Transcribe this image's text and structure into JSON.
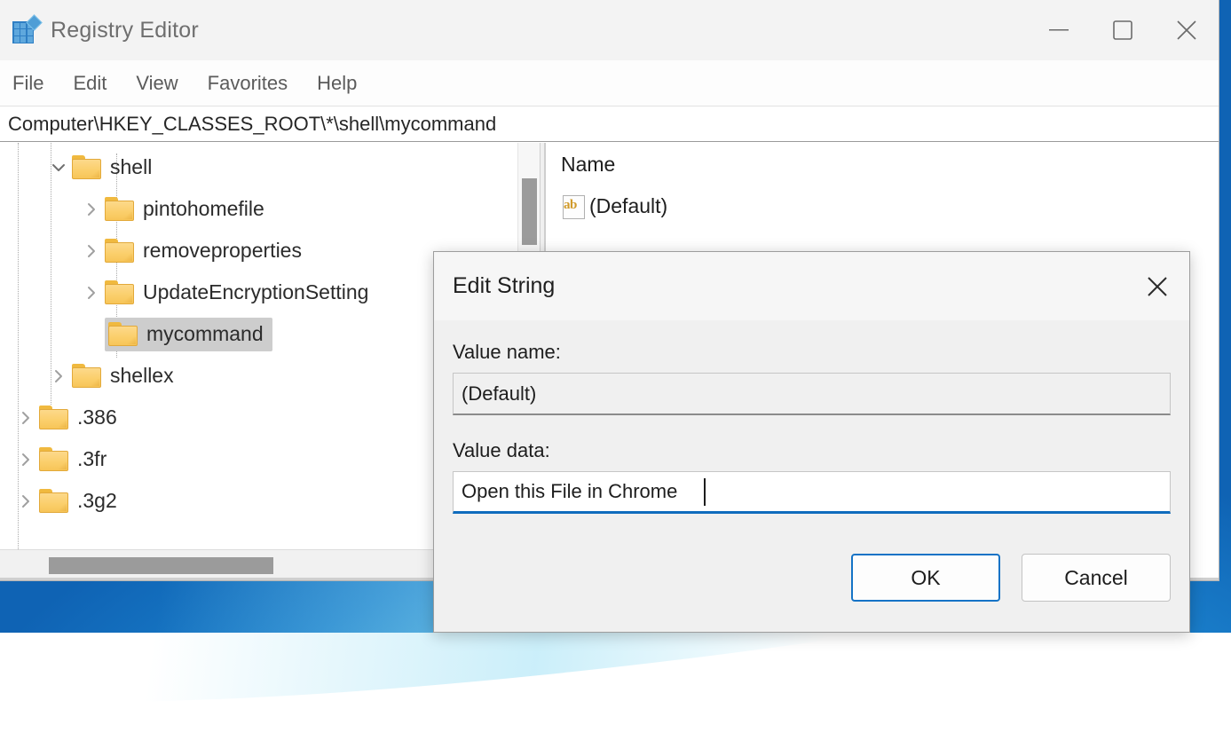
{
  "window": {
    "title": "Registry Editor",
    "icon": "registry-editor-icon",
    "controls": {
      "minimize": "minimize-icon",
      "maximize": "maximize-icon",
      "close": "close-icon"
    }
  },
  "menubar": {
    "items": [
      {
        "label": "File"
      },
      {
        "label": "Edit"
      },
      {
        "label": "View"
      },
      {
        "label": "Favorites"
      },
      {
        "label": "Help"
      }
    ]
  },
  "addressbar": {
    "path": "Computer\\HKEY_CLASSES_ROOT\\*\\shell\\mycommand"
  },
  "tree": {
    "nodes": [
      {
        "label": "shell",
        "indent": 2,
        "expander": "chevron-down",
        "selected": false
      },
      {
        "label": "pintohomefile",
        "indent": 3,
        "expander": "chevron-right",
        "selected": false
      },
      {
        "label": "removeproperties",
        "indent": 3,
        "expander": "chevron-right",
        "selected": false
      },
      {
        "label": "UpdateEncryptionSetting",
        "indent": 3,
        "expander": "chevron-right",
        "selected": false
      },
      {
        "label": "mycommand",
        "indent": 3,
        "expander": "none",
        "selected": true
      },
      {
        "label": "shellex",
        "indent": 2,
        "expander": "chevron-right",
        "selected": false
      },
      {
        "label": ".386",
        "indent": 1,
        "expander": "chevron-right",
        "selected": false
      },
      {
        "label": ".3fr",
        "indent": 1,
        "expander": "chevron-right",
        "selected": false
      },
      {
        "label": ".3g2",
        "indent": 1,
        "expander": "chevron-right",
        "selected": false
      }
    ]
  },
  "values": {
    "columns": [
      "Name"
    ],
    "rows": [
      {
        "icon": "string-value-icon",
        "name": "(Default)"
      }
    ]
  },
  "dialog": {
    "title": "Edit String",
    "close": "close-icon",
    "value_name_label": "Value name:",
    "value_name": "(Default)",
    "value_data_label": "Value data:",
    "value_data": "Open this File in Chrome ",
    "ok_label": "OK",
    "cancel_label": "Cancel"
  },
  "colors": {
    "accent": "#0f6cbd",
    "folder": "#f7c558",
    "selection": "#cdcdcd",
    "desktop": "#1680cf"
  }
}
